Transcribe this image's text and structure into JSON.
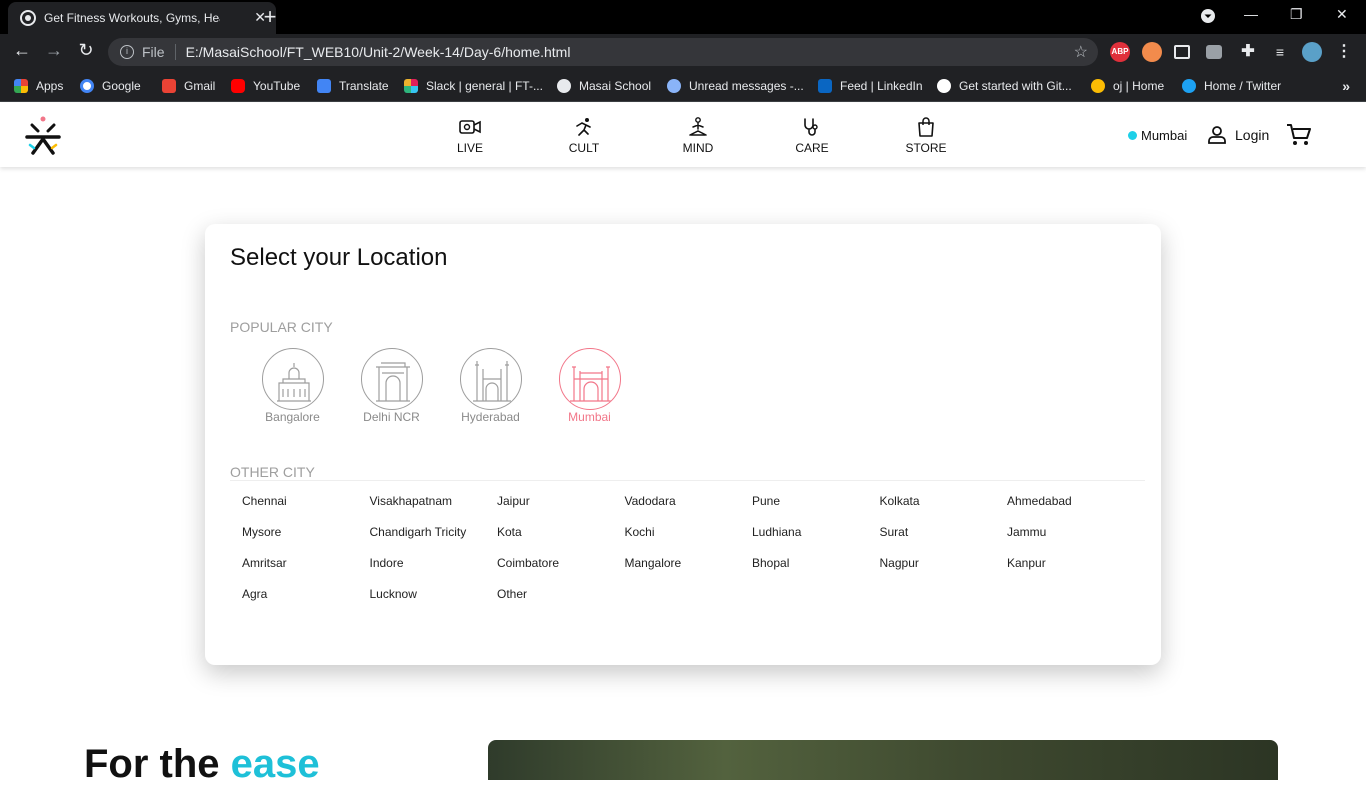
{
  "browser": {
    "tab_title": "Get Fitness Workouts, Gyms, Hea",
    "url_scheme": "File",
    "url": "E:/MasaiSchool/FT_WEB10/Unit-2/Week-14/Day-6/home.html",
    "extension_abp": "ABP",
    "bookmarks": [
      {
        "label": "Apps",
        "color": "#ea4335"
      },
      {
        "label": "Google",
        "color": "#4285f4"
      },
      {
        "label": "Gmail",
        "color": "#ea4335"
      },
      {
        "label": "YouTube",
        "color": "#ff0000"
      },
      {
        "label": "Translate",
        "color": "#4285f4"
      },
      {
        "label": "Slack | general | FT-...",
        "color": "#e01e5a"
      },
      {
        "label": "Masai School",
        "color": "#ffffff"
      },
      {
        "label": "Unread messages -...",
        "color": "#8ab4f8"
      },
      {
        "label": "Feed | LinkedIn",
        "color": "#0a66c2"
      },
      {
        "label": "Get started with Git...",
        "color": "#ffffff"
      },
      {
        "label": "oj | Home",
        "color": "#fbbc04"
      },
      {
        "label": "Home / Twitter",
        "color": "#1da1f2"
      }
    ]
  },
  "nav": {
    "items": [
      {
        "label": "LIVE",
        "icon": "video-icon"
      },
      {
        "label": "CULT",
        "icon": "running-icon"
      },
      {
        "label": "MIND",
        "icon": "meditation-icon"
      },
      {
        "label": "CARE",
        "icon": "stethoscope-icon"
      },
      {
        "label": "STORE",
        "icon": "shopping-bag-icon"
      }
    ],
    "location": "Mumbai",
    "login": "Login"
  },
  "modal": {
    "title": "Select your Location",
    "popular_title": "POPULAR CITY",
    "popular": [
      {
        "name": "Bangalore",
        "active": false
      },
      {
        "name": "Delhi NCR",
        "active": false
      },
      {
        "name": "Hyderabad",
        "active": false
      },
      {
        "name": "Mumbai",
        "active": true
      }
    ],
    "other_title": "OTHER CITY",
    "other": [
      "Chennai",
      "Visakhapatnam",
      "Jaipur",
      "Vadodara",
      "Pune",
      "Kolkata",
      "Ahmedabad",
      "Mysore",
      "Chandigarh Tricity",
      "Kota",
      "Kochi",
      "Ludhiana",
      "Surat",
      "Jammu",
      "Amritsar",
      "Indore",
      "Coimbatore",
      "Mangalore",
      "Bhopal",
      "Nagpur",
      "Kanpur",
      "Agra",
      "Lucknow",
      "Other"
    ]
  },
  "hero": {
    "text_plain": "For the ",
    "text_accent": "ease"
  },
  "colors": {
    "accent_pink": "#f27689",
    "location_dot": "#1ed0e8"
  }
}
